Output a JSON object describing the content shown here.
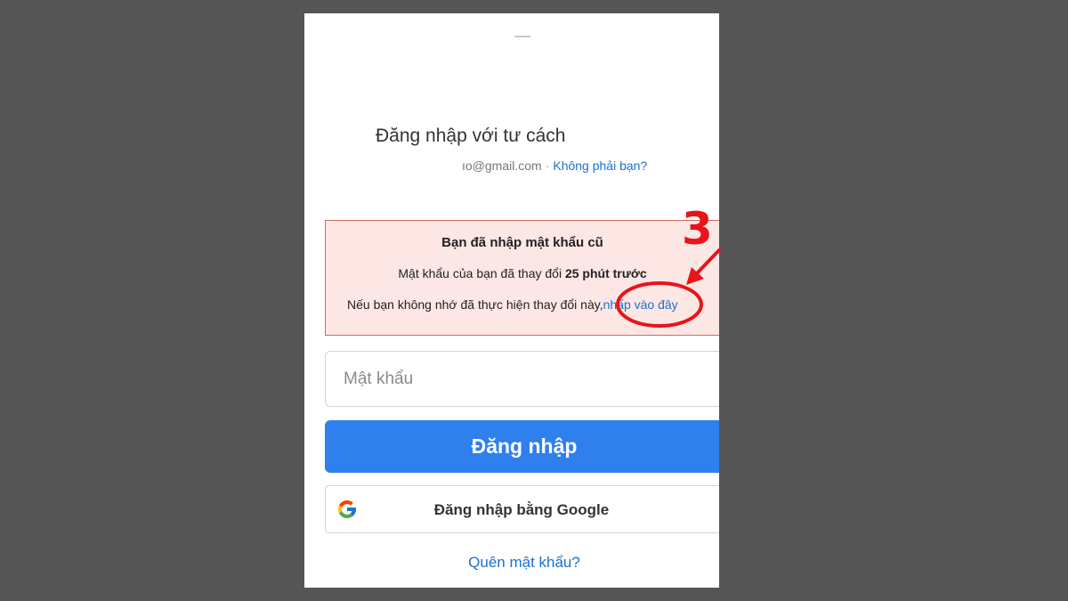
{
  "header": {
    "title": "Đăng nhập với tư cách",
    "email": "ıo@gmail.com",
    "separator": "·",
    "not_you_link": "Không phải bạn?"
  },
  "alert": {
    "title": "Bạn đã nhập mật khẩu cũ",
    "line1_prefix": "Mật khẩu của bạn đã thay đổi",
    "line1_bold": "25 phút trước",
    "line2_prefix": "Nếu bạn không nhớ đã thực hiện thay đổi này,",
    "line2_link": "nhấp vào đây"
  },
  "form": {
    "password_placeholder": "Mật khẩu",
    "login_label": "Đăng nhập",
    "google_label": "Đăng nhập bằng Google",
    "forgot_link": "Quên mật khẩu?"
  },
  "annotation": {
    "step_number": "3"
  },
  "colors": {
    "background": "#555555",
    "primary_button": "#2f80ed",
    "link": "#1a73c9",
    "alert_background": "#fde7e5",
    "annotation": "#e8141a"
  },
  "icons": [
    "google-logo-icon"
  ]
}
